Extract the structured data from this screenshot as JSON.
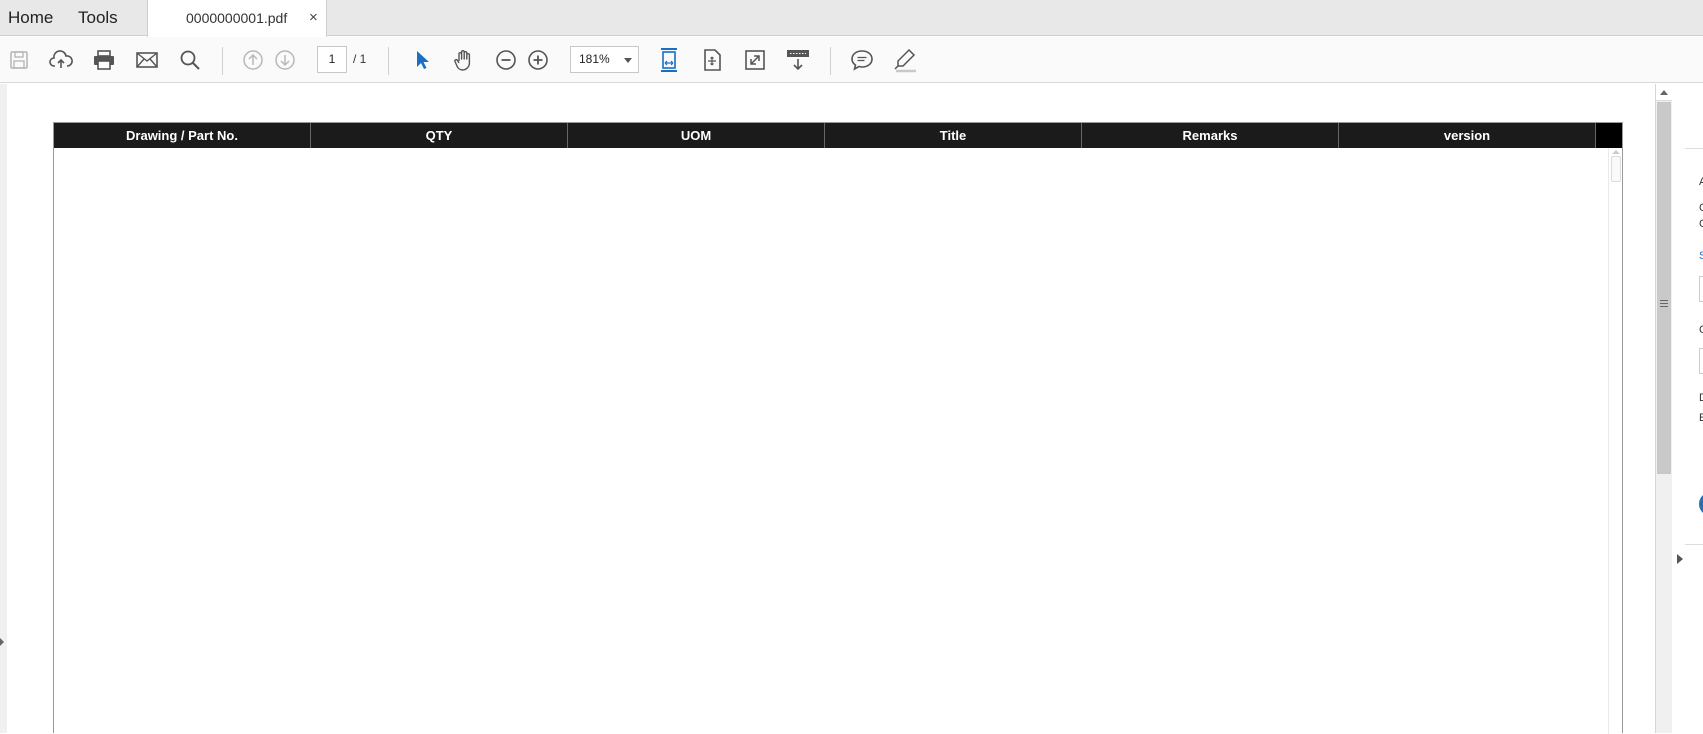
{
  "tabs": {
    "home": "Home",
    "tools": "Tools",
    "document": "0000000001.pdf",
    "close": "×"
  },
  "toolbar": {
    "page_current": "1",
    "page_total": "/ 1",
    "zoom": "181%"
  },
  "table": {
    "headers": [
      "Drawing / Part No.",
      "QTY",
      "UOM",
      "Title",
      "Remarks",
      "version"
    ]
  },
  "right_pane": {
    "fragments": [
      "A",
      "C",
      "C",
      "S",
      "C",
      "D",
      "E"
    ]
  },
  "colors": {
    "accent": "#1a6fc4",
    "header_bg": "#1b1b1b"
  }
}
